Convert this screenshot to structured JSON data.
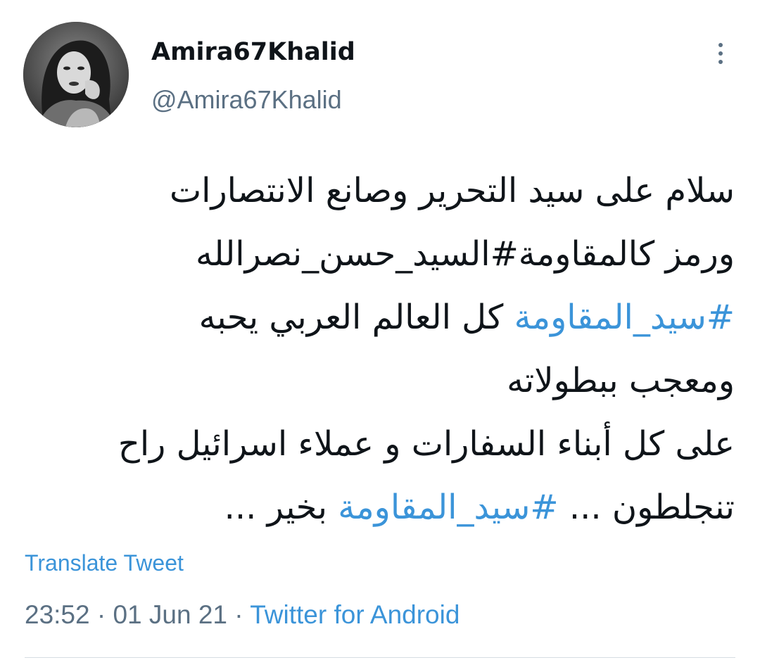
{
  "tweet": {
    "display_name": "Amira67Khalid",
    "handle": "@Amira67Khalid",
    "more_icon": "more-vertical-icon",
    "avatar_icon": "avatar-photo",
    "lines": [
      {
        "parts": [
          {
            "text": "سلام على سيد التحرير وصانع الانتصارات",
            "hashtag": false
          }
        ]
      },
      {
        "parts": [
          {
            "text": "ورمز كالمقاومة#السيد_حسن_نصرالله",
            "hashtag": false
          }
        ]
      },
      {
        "parts": [
          {
            "text": "#سيد_المقاومة",
            "hashtag": true
          },
          {
            "text": " كل العالم العربي يحبه",
            "hashtag": false
          }
        ]
      },
      {
        "parts": [
          {
            "text": "ومعجب ببطولاته",
            "hashtag": false
          }
        ]
      },
      {
        "parts": [
          {
            "text": "على كل أبناء السفارات و عملاء اسرائيل راح",
            "hashtag": false
          }
        ]
      },
      {
        "parts": [
          {
            "text": "تنجلطون ... ",
            "hashtag": false
          },
          {
            "text": "#سيد_المقاومة",
            "hashtag": true
          },
          {
            "text": " بخير ...",
            "hashtag": false
          }
        ]
      }
    ],
    "translate_label": "Translate Tweet",
    "time": "23:52",
    "separator": " · ",
    "date": "01 Jun 21",
    "source": "Twitter for Android"
  },
  "colors": {
    "link": "#3b94d9",
    "secondary_text": "#5b7083",
    "primary_text": "#0f1419"
  }
}
